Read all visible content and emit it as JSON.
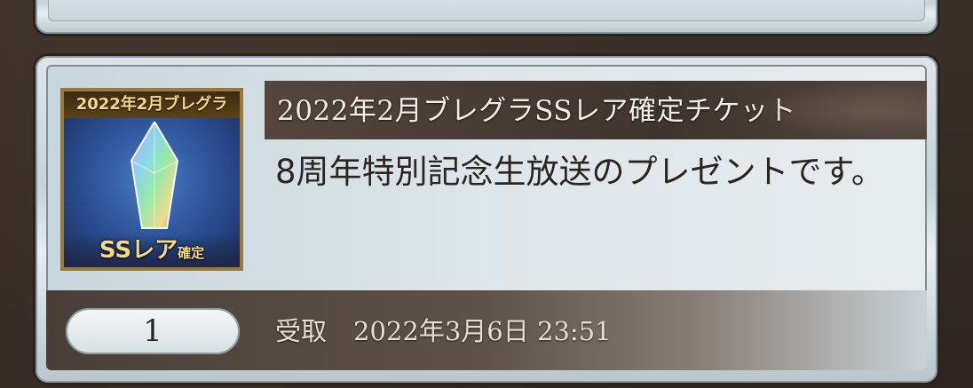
{
  "item": {
    "title": "2022年2月ブレグラSSレア確定チケット",
    "description": "8周年特別記念生放送のプレゼントです。",
    "thumbnail": {
      "top_text": "2022年2月ブレグラ",
      "bottom_text": "SSレア",
      "bottom_small": "確定"
    },
    "quantity": "1",
    "status_label": "受取",
    "received_datetime": "2022年3月6日 23:51"
  }
}
